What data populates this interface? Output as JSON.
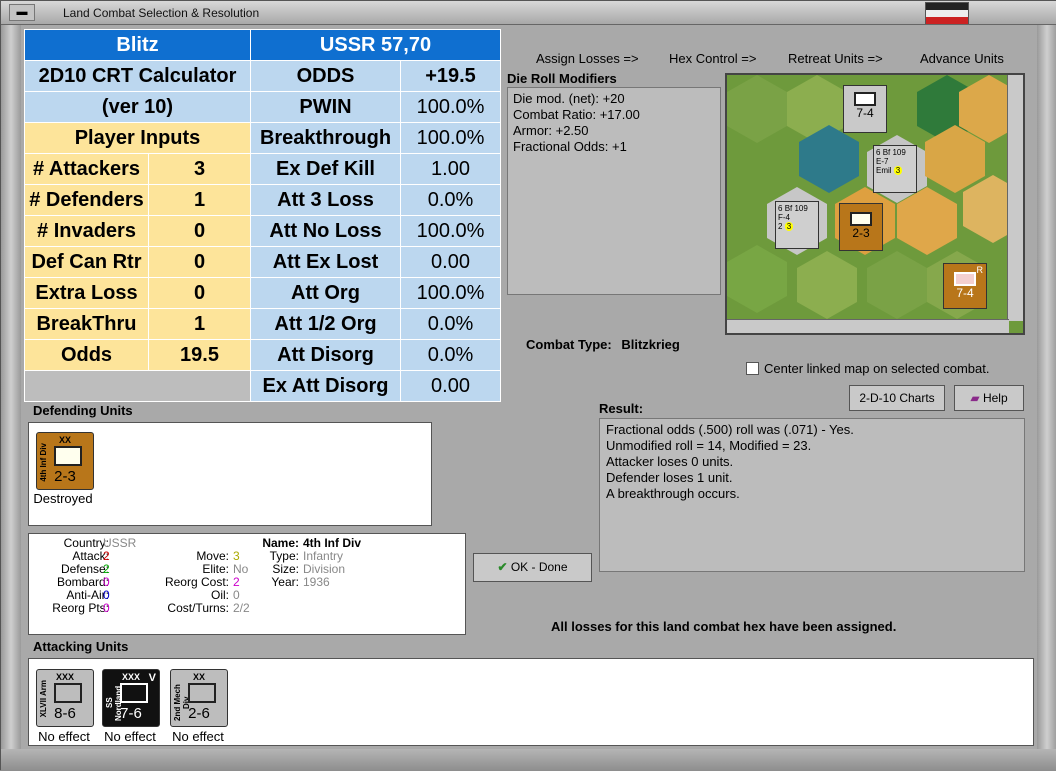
{
  "window": {
    "title": "Land Combat Selection & Resolution"
  },
  "crt": {
    "left_title": "Blitz",
    "right_title": "USSR 57,70",
    "calc_line1": "2D10 CRT Calculator",
    "calc_line2": "(ver 10)",
    "player_inputs": "Player Inputs",
    "inputs": [
      {
        "label": "# Attackers",
        "value": "3"
      },
      {
        "label": "# Defenders",
        "value": "1"
      },
      {
        "label": "# Invaders",
        "value": "0"
      },
      {
        "label": "Def Can Rtr",
        "value": "0"
      },
      {
        "label": "Extra Loss",
        "value": "0"
      },
      {
        "label": "BreakThru",
        "value": "1"
      },
      {
        "label": "Odds",
        "value": "19.5"
      }
    ],
    "outputs": [
      {
        "label": "ODDS",
        "value": "+19.5"
      },
      {
        "label": "PWIN",
        "value": "100.0%"
      },
      {
        "label": "Breakthrough",
        "value": "100.0%"
      },
      {
        "label": "Ex Def Kill",
        "value": "1.00"
      },
      {
        "label": "Att 3 Loss",
        "value": "0.0%"
      },
      {
        "label": "Att No Loss",
        "value": "100.0%"
      },
      {
        "label": "Att Ex Lost",
        "value": "0.00"
      },
      {
        "label": "Att Org",
        "value": "100.0%"
      },
      {
        "label": "Att 1/2 Org",
        "value": "0.0%"
      },
      {
        "label": "Att Disorg",
        "value": "0.0%"
      },
      {
        "label": "Ex Att Disorg",
        "value": "0.00"
      }
    ]
  },
  "actions": [
    "Assign Losses =>",
    "Hex Control =>",
    "Retreat Units =>",
    "Advance Units"
  ],
  "drm": {
    "title": "Die Roll Modifiers",
    "lines": [
      "Die mod. (net): +20",
      "",
      "Combat Ratio: +17.00",
      "Armor: +2.50",
      "Fractional Odds: +1"
    ]
  },
  "map": {
    "counters": [
      {
        "name": "infantry-top",
        "label": "7-4"
      },
      {
        "name": "air-emil",
        "top": "Bf 109",
        "mid": "E-7",
        "sub": "Emil",
        "num": "6",
        "range": "3"
      },
      {
        "name": "air-f4",
        "top": "Bf 109",
        "mid": "F-4",
        "num": "6",
        "range": "3",
        "num2": "2"
      },
      {
        "name": "defender-map",
        "label": "2-3",
        "side": "4th Inf Div"
      },
      {
        "name": "soviet-right",
        "label": "7-4",
        "badge": "R"
      }
    ]
  },
  "combat_type": {
    "label": "Combat Type:",
    "value": "Blitzkrieg"
  },
  "center_linked": "Center linked map on selected combat.",
  "buttons": {
    "charts": "2-D-10 Charts",
    "help": "Help",
    "ok": "OK - Done"
  },
  "defending": {
    "title": "Defending Units",
    "units": [
      {
        "side": "4th Inf Div",
        "size": "XX",
        "strength": "2-3",
        "status": "Destroyed"
      }
    ]
  },
  "result": {
    "title": "Result:",
    "lines": [
      "Fractional odds (.500) roll was (.071)  - Yes.",
      "Unmodified roll = 14, Modified = 23.",
      "Attacker loses 0 units.",
      "Defender loses 1 unit.",
      "A breakthrough occurs."
    ]
  },
  "stats": {
    "country": "USSR",
    "attack": "2",
    "defense": "2",
    "bombard": "0",
    "anti_air": "0",
    "reorg_pts": "0",
    "move": "3",
    "elite": "No",
    "reorg_cost": "2",
    "oil": "0",
    "cost_turns": "2/2",
    "name": "4th Inf Div",
    "type": "Infantry",
    "size": "Division",
    "year": "1936",
    "labels": {
      "country": "Country:",
      "attack": "Attack:",
      "defense": "Defense:",
      "bombard": "Bombard:",
      "anti_air": "Anti-Air:",
      "reorg_pts": "Reorg Pts:",
      "move": "Move:",
      "elite": "Elite:",
      "reorg_cost": "Reorg Cost:",
      "oil": "Oil:",
      "cost_turns": "Cost/Turns:",
      "name": "Name:",
      "type": "Type:",
      "size": "Size:",
      "year": "Year:"
    }
  },
  "note": "All losses for this land combat hex have been assigned.",
  "attacking": {
    "title": "Attacking Units",
    "units": [
      {
        "side": "XLVII Arm",
        "size": "XXX",
        "strength": "8-6",
        "status": "No effect"
      },
      {
        "side": "SS Nordland",
        "size": "XXX",
        "strength": "7-6",
        "status": "No effect",
        "badge": "V"
      },
      {
        "side": "2nd Mech Div",
        "size": "XX",
        "strength": "2-6",
        "status": "No effect"
      }
    ]
  }
}
